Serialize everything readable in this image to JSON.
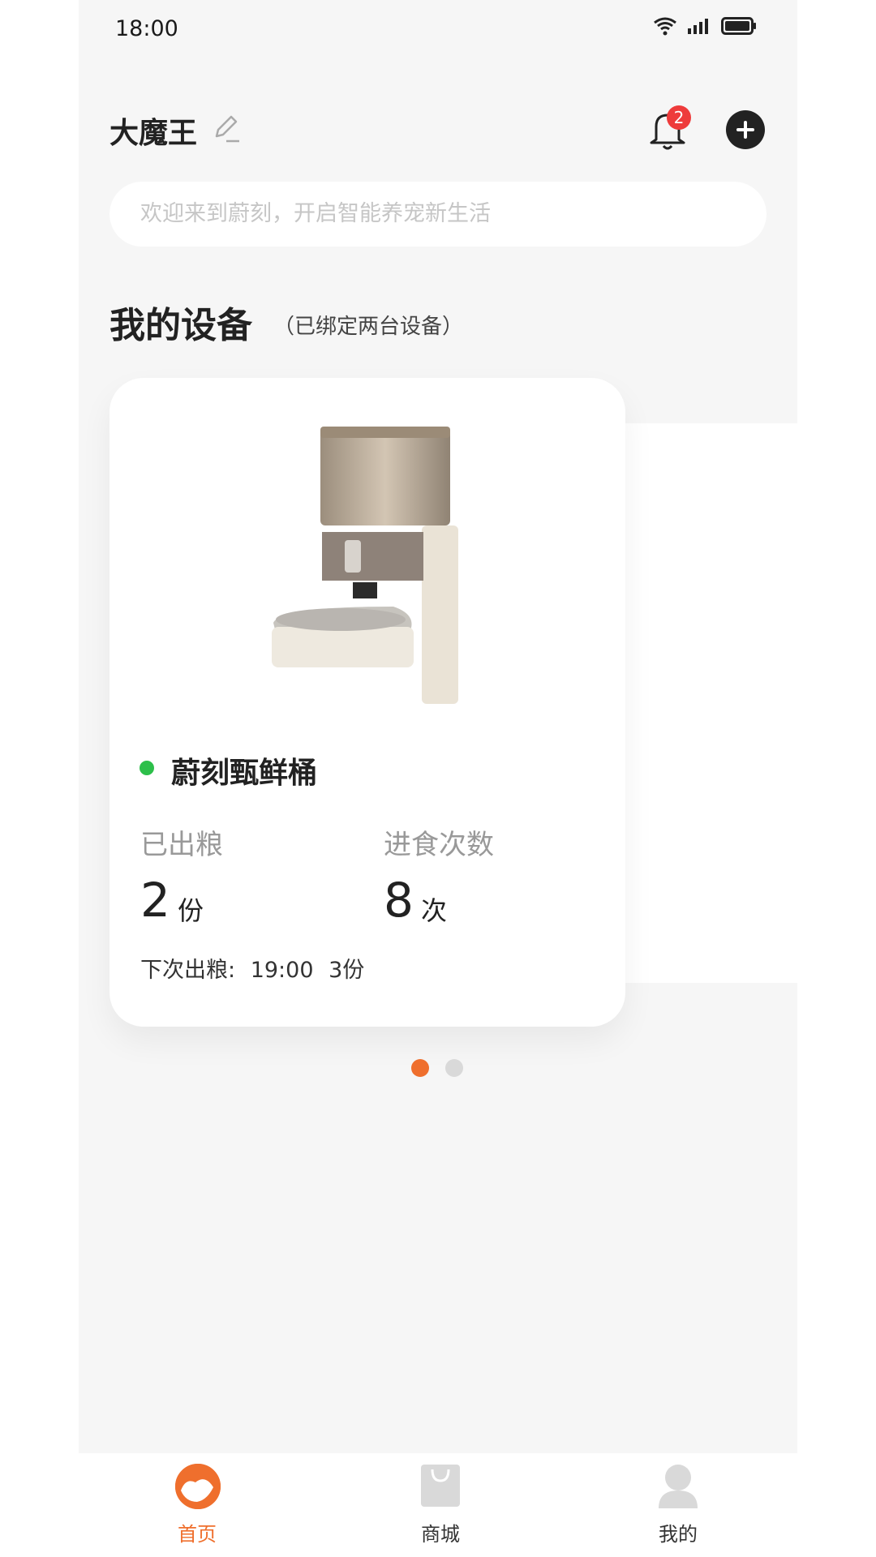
{
  "status_bar": {
    "time": "18:00"
  },
  "header": {
    "user_name": "大魔王",
    "notification_count": "2"
  },
  "search": {
    "placeholder": "欢迎来到蔚刻，开启智能养宠新生活"
  },
  "devices_section": {
    "title": "我的设备",
    "subtitle": "（已绑定两台设备）"
  },
  "device_card": {
    "name": "蔚刻甄鲜桶",
    "status": "online",
    "stats": [
      {
        "label": "已出粮",
        "value": "2",
        "unit": "份"
      },
      {
        "label": "进食次数",
        "value": "8",
        "unit": "次"
      }
    ],
    "next_feed_label": "下次出粮:",
    "next_feed_time": "19:00",
    "next_feed_amount": "3份"
  },
  "pagination": {
    "total": 2,
    "active": 0
  },
  "tabbar": {
    "items": [
      {
        "label": "首页",
        "icon": "home-icon",
        "active": true
      },
      {
        "label": "商城",
        "icon": "shopping-bag-icon",
        "active": false
      },
      {
        "label": "我的",
        "icon": "user-icon",
        "active": false
      }
    ]
  },
  "colors": {
    "accent": "#ef6f2d",
    "online": "#2dbf4a",
    "badge": "#ee3b3b"
  }
}
